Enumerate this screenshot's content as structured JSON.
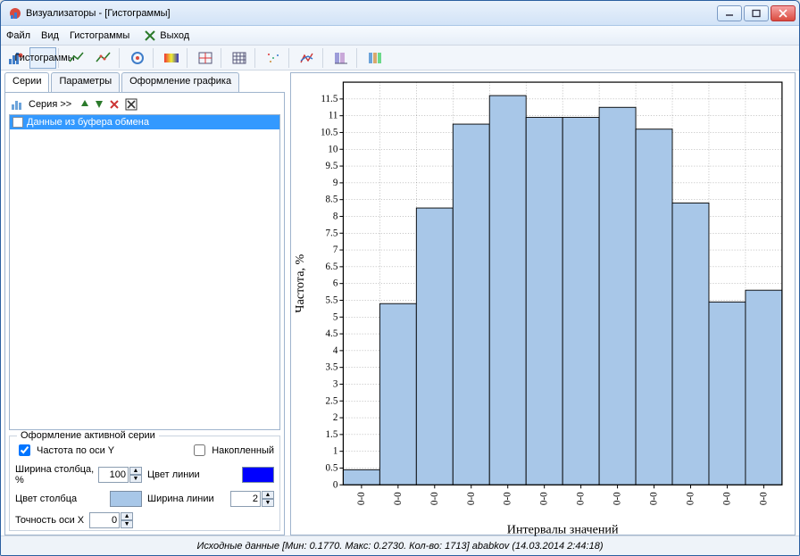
{
  "window": {
    "title": "Визуализаторы - [Гистограммы]"
  },
  "menu": {
    "file": "Файл",
    "view": "Вид",
    "histograms": "Гистограммы",
    "exit": "Выход"
  },
  "iconbar_active_label": "Гистограммы",
  "tabs": {
    "series": "Серии",
    "params": "Параметры",
    "design": "Оформление графика"
  },
  "seriesbar": {
    "label": "Серия >>"
  },
  "series_item": "Данные из буфера обмена",
  "groupbox_title": "Оформление активной серии",
  "opts": {
    "freq_y": "Частота по оси Y",
    "accumulated": "Накопленный",
    "bar_width_label": "Ширина столбца, %",
    "bar_width_value": "100",
    "bar_color_label": "Цвет столбца",
    "bar_color": "#a8c7e8",
    "line_color_label": "Цвет линии",
    "line_color": "#0000ff",
    "line_width_label": "Ширина линии",
    "line_width_value": "2",
    "x_precision_label": "Точность оси X",
    "x_precision_value": "0"
  },
  "status": "Исходные данные [Мин: 0.1770. Макс: 0.2730. Кол-во: 1713] ababkov (14.03.2014 2:44:18)",
  "chart_data": {
    "type": "bar",
    "categories": [
      "0-0",
      "0-0",
      "0-0",
      "0-0",
      "0-0",
      "0-0",
      "0-0",
      "0-0",
      "0-0",
      "0-0",
      "0-0",
      "0-0"
    ],
    "values": [
      0.45,
      5.4,
      8.25,
      10.75,
      11.6,
      10.95,
      10.95,
      11.25,
      10.6,
      8.4,
      5.45,
      5.8
    ],
    "title": "",
    "xlabel": "Интервалы значений",
    "ylabel": "Частота, %",
    "ylim": [
      0,
      12
    ],
    "yticks": [
      0,
      0.5,
      1,
      1.5,
      2,
      2.5,
      3,
      3.5,
      4,
      4.5,
      5,
      5.5,
      6,
      6.5,
      7,
      7.5,
      8,
      8.5,
      9,
      9.5,
      10,
      10.5,
      11,
      11.5
    ]
  }
}
